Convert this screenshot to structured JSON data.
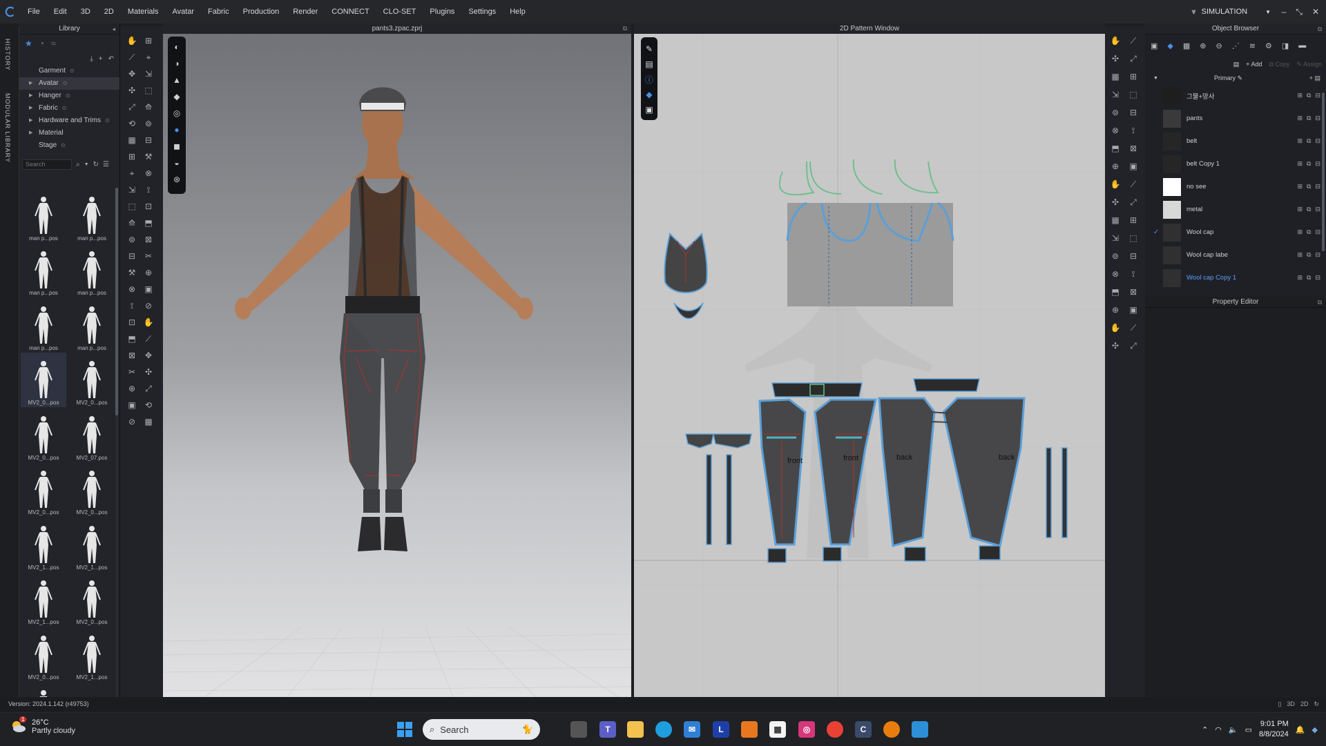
{
  "menubar": {
    "items": [
      "File",
      "Edit",
      "3D",
      "2D",
      "Materials",
      "Avatar",
      "Fabric",
      "Production",
      "Render",
      "CONNECT",
      "CLO-SET",
      "Plugins",
      "Settings",
      "Help"
    ],
    "mode": "SIMULATION"
  },
  "vtabs": {
    "history": "HISTORY",
    "modular": "MODULAR LIBRARY"
  },
  "library": {
    "title": "Library",
    "tree": [
      {
        "label": "Garment",
        "expandable": false
      },
      {
        "label": "Avatar",
        "expandable": true,
        "selected": true
      },
      {
        "label": "Hanger",
        "expandable": true
      },
      {
        "label": "Fabric",
        "expandable": true
      },
      {
        "label": "Hardware and Trims",
        "expandable": true
      },
      {
        "label": "Material",
        "expandable": true
      },
      {
        "label": "Stage",
        "expandable": false
      }
    ],
    "search_placeholder": "Search",
    "thumbs": [
      "man p...pos",
      "man p...pos",
      "man p...pos",
      "man p...pos",
      "man p...pos",
      "man p...pos",
      "MV2_0...pos",
      "MV2_0...pos",
      "MV2_0...pos",
      "MV2_07.pos",
      "MV2_0...pos",
      "MV2_0...pos",
      "MV2_1...pos",
      "MV2_1...pos",
      "MV2_1...pos",
      "MV2_0...pos",
      "MV2_0...pos",
      "MV2_1...pos",
      "MV2_0...pos"
    ]
  },
  "viewport": {
    "title": "pants3.zpac.zprj"
  },
  "pattern": {
    "title": "2D Pattern Window",
    "labels": {
      "front1": "front",
      "front2": "front",
      "back1": "back",
      "back2": "back"
    }
  },
  "object_browser": {
    "title": "Object Browser",
    "add": "Add",
    "copy": "Copy",
    "assign": "Assign",
    "group": "Primary",
    "rows": [
      {
        "name": "그물+망사",
        "swatch": "#1e1e1e",
        "checked": false,
        "highlight": false
      },
      {
        "name": "pants",
        "swatch": "#3a3a3a",
        "checked": false,
        "highlight": false
      },
      {
        "name": "belt",
        "swatch": "#262626",
        "checked": false,
        "highlight": false
      },
      {
        "name": "belt Copy 1",
        "swatch": "#262626",
        "checked": false,
        "highlight": false
      },
      {
        "name": "no see",
        "swatch": "#ffffff",
        "checked": false,
        "highlight": false
      },
      {
        "name": "metal",
        "swatch": "#d8d8d8",
        "checked": false,
        "highlight": false
      },
      {
        "name": "Wool cap",
        "swatch": "#303030",
        "checked": true,
        "highlight": false
      },
      {
        "name": "Wool cap labe",
        "swatch": "#303030",
        "checked": false,
        "highlight": false
      },
      {
        "name": "Wool cap Copy 1",
        "swatch": "#303030",
        "checked": false,
        "highlight": true
      }
    ]
  },
  "property_editor": {
    "title": "Property Editor"
  },
  "statusbar": {
    "version": "Version: 2024.1.142 (r49753)"
  },
  "taskbar": {
    "temp": "26°C",
    "condition": "Partly cloudy",
    "weather_badge": "1",
    "search": "Search",
    "time": "9:01 PM",
    "date": "8/8/2024"
  },
  "colors": {
    "accent": "#4a90e2",
    "seam_red": "#c0392b",
    "outline_blue": "#5b9fd8",
    "outline_green": "#6fbf8e"
  }
}
